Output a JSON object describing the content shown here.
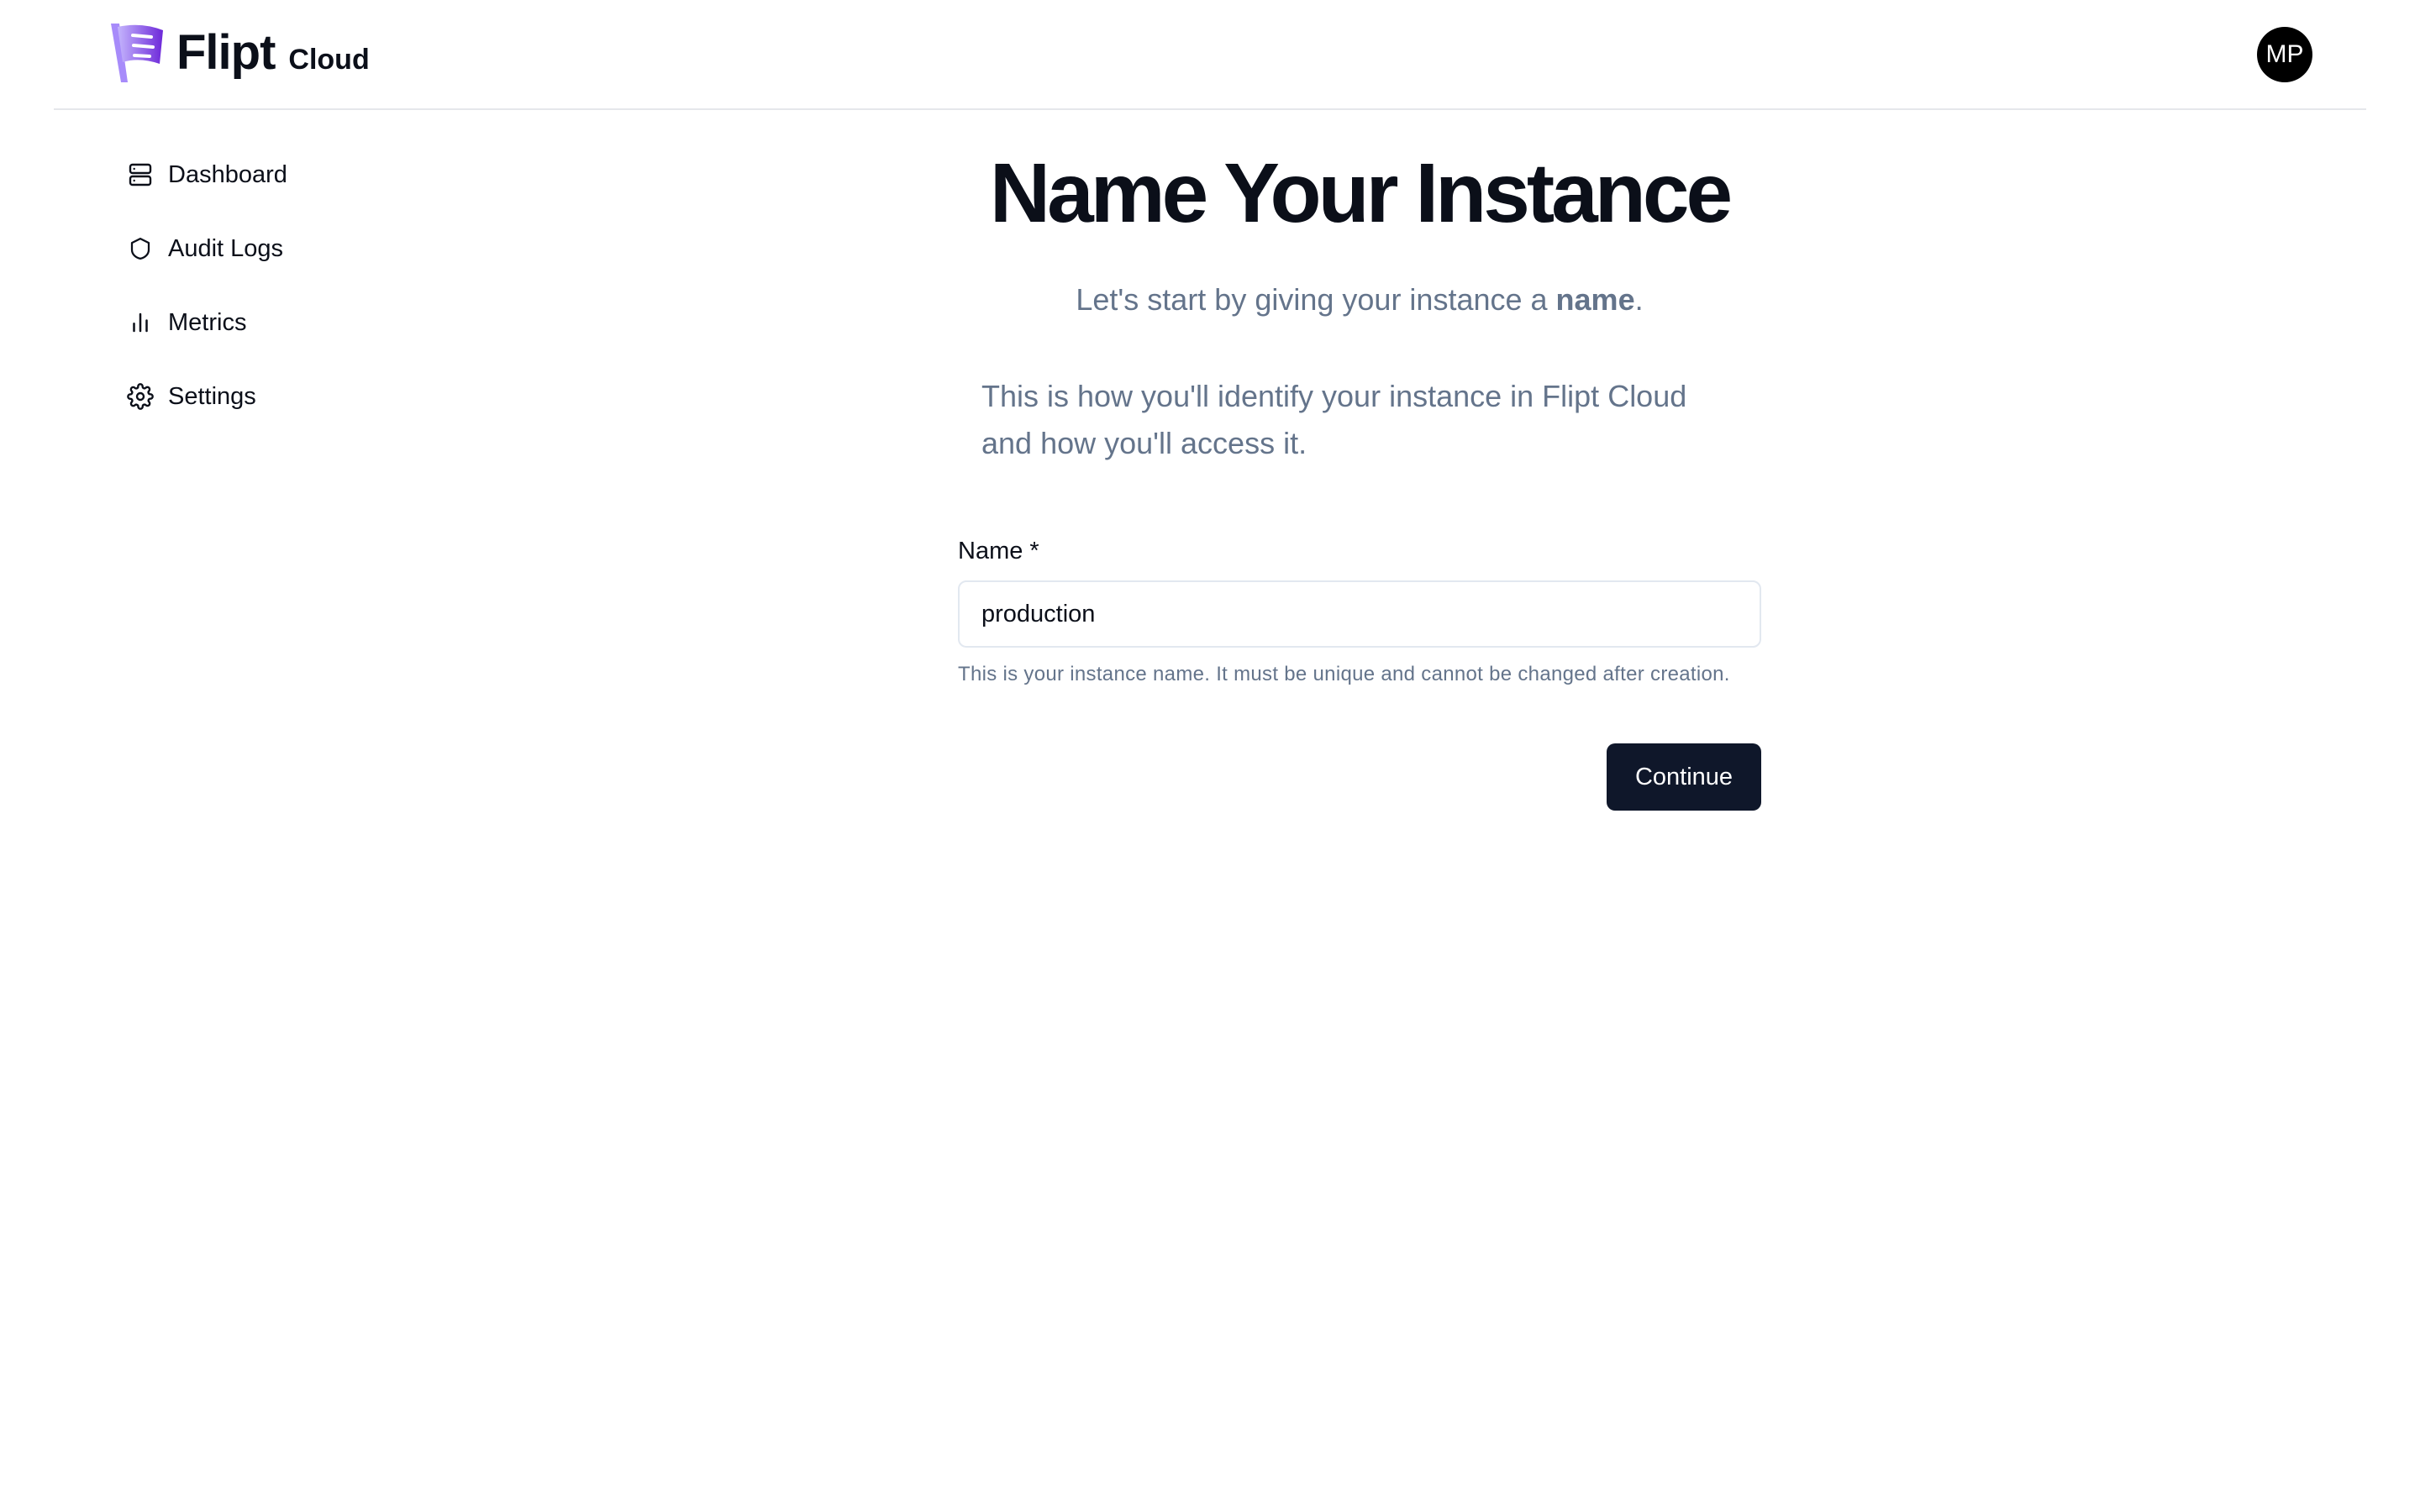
{
  "header": {
    "logo_word": "Flipt",
    "logo_sub": "Cloud",
    "avatar_initials": "MP"
  },
  "sidebar": {
    "items": [
      {
        "label": "Dashboard",
        "icon": "server-icon"
      },
      {
        "label": "Audit Logs",
        "icon": "shield-icon"
      },
      {
        "label": "Metrics",
        "icon": "bar-chart-icon"
      },
      {
        "label": "Settings",
        "icon": "gear-icon"
      }
    ]
  },
  "main": {
    "title": "Name Your Instance",
    "subtitle_prefix": "Let's start by giving your instance a ",
    "subtitle_bold": "name",
    "subtitle_suffix": ".",
    "description": "This is how you'll identify your instance in Flipt Cloud and how you'll access it.",
    "form": {
      "name_label": "Name *",
      "name_value": "production",
      "name_help": "This is your instance name. It must be unique and cannot be changed after creation.",
      "continue_label": "Continue"
    }
  },
  "colors": {
    "brand_purple": "#7c3aed",
    "button_bg": "#0f172a",
    "muted_text": "#64748b"
  }
}
